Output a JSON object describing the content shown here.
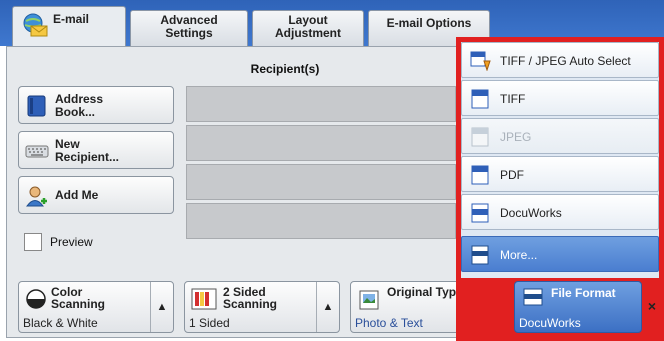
{
  "tabs": [
    {
      "label": "E-mail"
    },
    {
      "label": "Advanced Settings"
    },
    {
      "label": "Layout Adjustment"
    },
    {
      "label": "E-mail Options"
    }
  ],
  "recipients": {
    "header": "Recipient(s)"
  },
  "left_buttons": {
    "address_book": "Address Book...",
    "new_recipient": "New Recipient...",
    "add_me": "Add Me"
  },
  "preview": {
    "label": "Preview"
  },
  "bottom": {
    "color": {
      "title": "Color Scanning",
      "value": "Black & White"
    },
    "sided": {
      "title": "2 Sided Scanning",
      "value": "1 Sided"
    },
    "original": {
      "title": "Original Type",
      "value": "Photo & Text"
    },
    "file_format": {
      "title": "File Format",
      "value": "DocuWorks"
    }
  },
  "dropdown": {
    "items": [
      {
        "label": "TIFF / JPEG Auto Select",
        "icon": "tiff-jpeg-icon",
        "enabled": true
      },
      {
        "label": "TIFF",
        "icon": "tiff-icon",
        "enabled": true
      },
      {
        "label": "JPEG",
        "icon": "jpeg-icon",
        "enabled": false
      },
      {
        "label": "PDF",
        "icon": "pdf-icon",
        "enabled": true
      },
      {
        "label": "DocuWorks",
        "icon": "docuworks-icon",
        "enabled": true
      },
      {
        "label": "More...",
        "icon": "more-icon",
        "enabled": true
      }
    ],
    "highlight_color": "#e12020",
    "accent": "#4a7ed0"
  },
  "close": "×"
}
